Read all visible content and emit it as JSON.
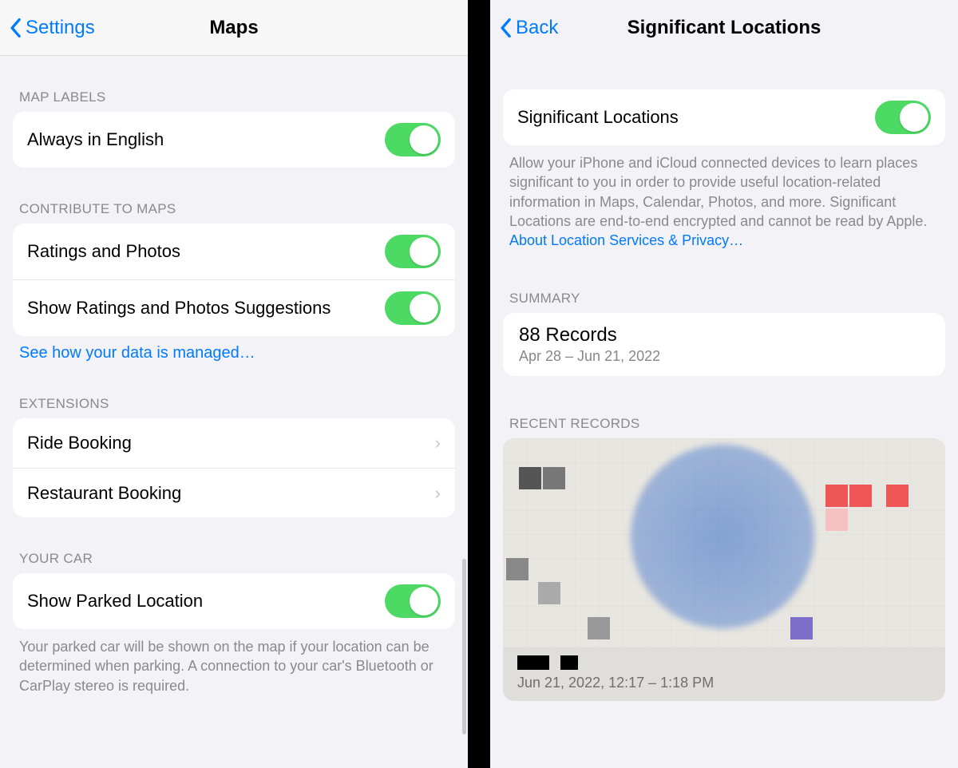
{
  "left": {
    "nav": {
      "back_label": "Settings",
      "title": "Maps"
    },
    "map_labels": {
      "header": "MAP LABELS",
      "always_english": "Always in English"
    },
    "contribute": {
      "header": "CONTRIBUTE TO MAPS",
      "ratings_photos": "Ratings and Photos",
      "show_suggestions": "Show Ratings and Photos Suggestions",
      "footer_link": "See how your data is managed…"
    },
    "extensions": {
      "header": "EXTENSIONS",
      "ride": "Ride Booking",
      "restaurant": "Restaurant Booking"
    },
    "car": {
      "header": "YOUR CAR",
      "show_parked": "Show Parked Location",
      "footer_text": "Your parked car will be shown on the map if your location can be determined when parking. A connection to your car's Bluetooth or CarPlay stereo is required."
    }
  },
  "right": {
    "nav": {
      "back_label": "Back",
      "title": "Significant Locations"
    },
    "sig": {
      "row_label": "Significant Locations",
      "footer_text": "Allow your iPhone and iCloud connected devices to learn places significant to you in order to provide useful location-related information in Maps, Calendar, Photos, and more. Significant Locations are end-to-end encrypted and cannot be read by Apple.",
      "footer_link": "About Location Services & Privacy…"
    },
    "summary": {
      "header": "SUMMARY",
      "title": "88 Records",
      "range": "Apr 28 – Jun 21, 2022"
    },
    "recent": {
      "header": "RECENT RECORDS",
      "caption": "Jun 21, 2022, 12:17 – 1:18 PM"
    }
  }
}
